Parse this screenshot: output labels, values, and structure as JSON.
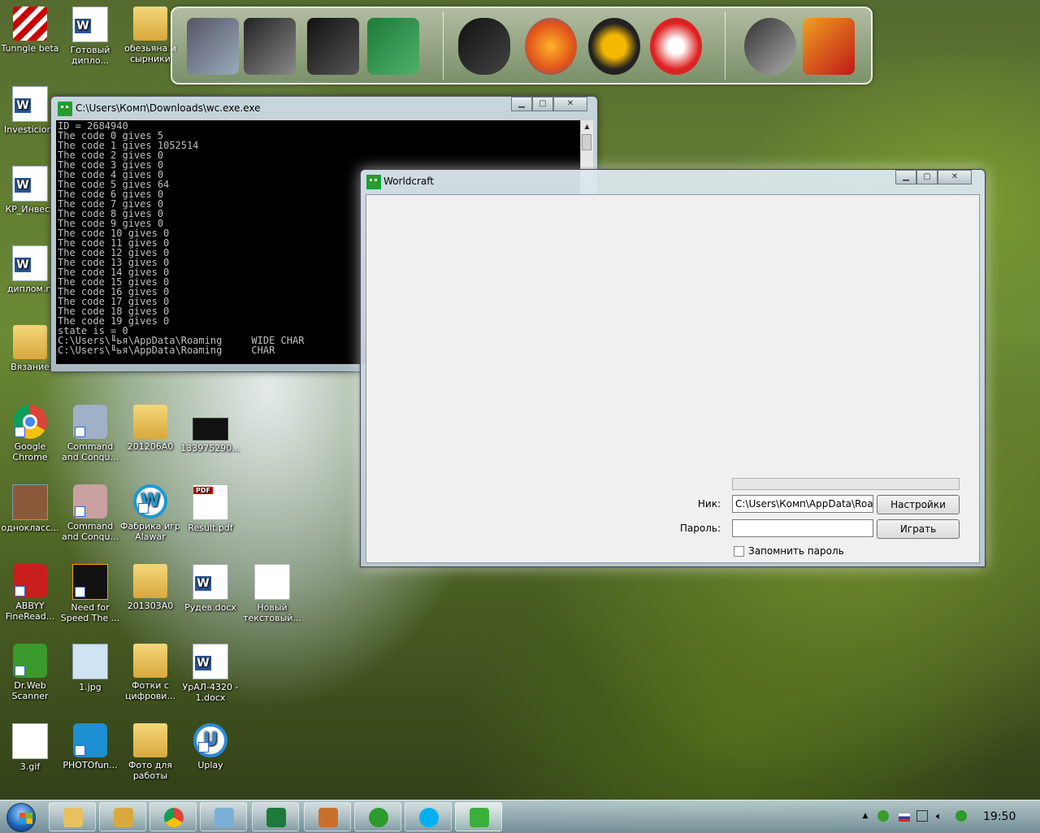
{
  "desktop": {
    "icons": [
      {
        "label": "Tunngle beta"
      },
      {
        "label": "Готовый дипло..."
      },
      {
        "label": "обезьяна и сырники"
      },
      {
        "label": "Investicionr"
      },
      {
        "label": "КР_Инвест"
      },
      {
        "label": "диплом.rt"
      },
      {
        "label": "Вязание"
      },
      {
        "label": "Google Chrome"
      },
      {
        "label": "Command and Conqu..."
      },
      {
        "label": "201206A0"
      },
      {
        "label": "133975290..."
      },
      {
        "label": "однокласс..."
      },
      {
        "label": "Command and Conqu..."
      },
      {
        "label": "Фабрика игр Alawar"
      },
      {
        "label": "Result.pdf"
      },
      {
        "label": "ABBYY FineRead..."
      },
      {
        "label": "Need for Speed The ..."
      },
      {
        "label": "201303A0"
      },
      {
        "label": "Рудев.docx"
      },
      {
        "label": "Новый текстовый..."
      },
      {
        "label": "Dr.Web Scanner"
      },
      {
        "label": "1.jpg"
      },
      {
        "label": "Фотки с цифрови..."
      },
      {
        "label": "УрАЛ-4320 - 1.docx"
      },
      {
        "label": "3.gif"
      },
      {
        "label": "PHOTOfun..."
      },
      {
        "label": "Фото для работы"
      },
      {
        "label": "Uplay"
      }
    ]
  },
  "console": {
    "title": "C:\\Users\\Комп\\Downloads\\wc.exe.exe",
    "lines": [
      "ID = 2684940",
      "The code 0 gives 5",
      "The code 1 gives 1052514",
      "The code 2 gives 0",
      "The code 3 gives 0",
      "The code 4 gives 0",
      "The code 5 gives 64",
      "The code 6 gives 0",
      "The code 7 gives 0",
      "The code 8 gives 0",
      "The code 9 gives 0",
      "The code 10 gives 0",
      "The code 11 gives 0",
      "The code 12 gives 0",
      "The code 13 gives 0",
      "The code 14 gives 0",
      "The code 15 gives 0",
      "The code 16 gives 0",
      "The code 17 gives 0",
      "The code 18 gives 0",
      "The code 19 gives 0",
      "state is = 0",
      "C:\\Users\\╙ья\\AppData\\Roaming     WIDE CHAR",
      "C:\\Users\\╙ья\\AppData\\Roaming     CHAR"
    ]
  },
  "worldcraft": {
    "title": "Worldcraft",
    "progress": 0,
    "nick_label": "Ник:",
    "nick_value": "C:\\Users\\Комп\\AppData\\Roaming",
    "password_label": "Пароль:",
    "password_value": "",
    "settings_button": "Настройки",
    "play_button": "Играть",
    "remember_label": "Запомнить пароль",
    "remember_checked": false
  },
  "taskbar": {
    "clock": "19:50"
  }
}
